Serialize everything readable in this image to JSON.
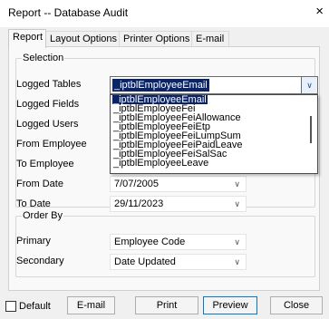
{
  "window": {
    "title": "Report -- Database Audit",
    "close_glyph": "×"
  },
  "tabs": [
    {
      "label": "Report",
      "active": true
    },
    {
      "label": "Layout Options",
      "active": false
    },
    {
      "label": "Printer Options",
      "active": false
    },
    {
      "label": "E-mail",
      "active": false
    }
  ],
  "selection": {
    "group_label": "Selection",
    "logged_tables": {
      "label": "Logged Tables",
      "value": "_iptblEmployeeEmail"
    },
    "logged_fields": {
      "label": "Logged Fields"
    },
    "logged_users": {
      "label": "Logged Users"
    },
    "from_employee": {
      "label": "From Employee"
    },
    "to_employee": {
      "label": "To Employee"
    },
    "from_date": {
      "label": "From Date",
      "value": "7/07/2005"
    },
    "to_date": {
      "label": "To Date",
      "value": "29/11/2023"
    }
  },
  "tables_dropdown": {
    "options": [
      "_iptblEmployeeEmail",
      "_iptblEmployeeFei",
      "_iptblEmployeeFeiAllowance",
      "_iptblEmployeeFeiEtp",
      "_iptblEmployeeFeiLumpSum",
      "_iptblEmployeeFeiPaidLeave",
      "_iptblEmployeeFeiSalSac",
      "_iptblEmployeeLeave"
    ],
    "highlighted_index": 0
  },
  "order_by": {
    "group_label": "Order By",
    "primary": {
      "label": "Primary",
      "value": "Employee Code"
    },
    "secondary": {
      "label": "Secondary",
      "value": "Date Updated"
    }
  },
  "footer": {
    "default_label": "Default",
    "email_label": "E-mail",
    "print_label": "Print",
    "preview_label": "Preview",
    "close_label": "Close"
  },
  "colors": {
    "selection": "#0a246a",
    "focus_border": "#0078d7",
    "tab_panel": "#f9f9f9",
    "dialog_bg": "#f0f0f0"
  }
}
